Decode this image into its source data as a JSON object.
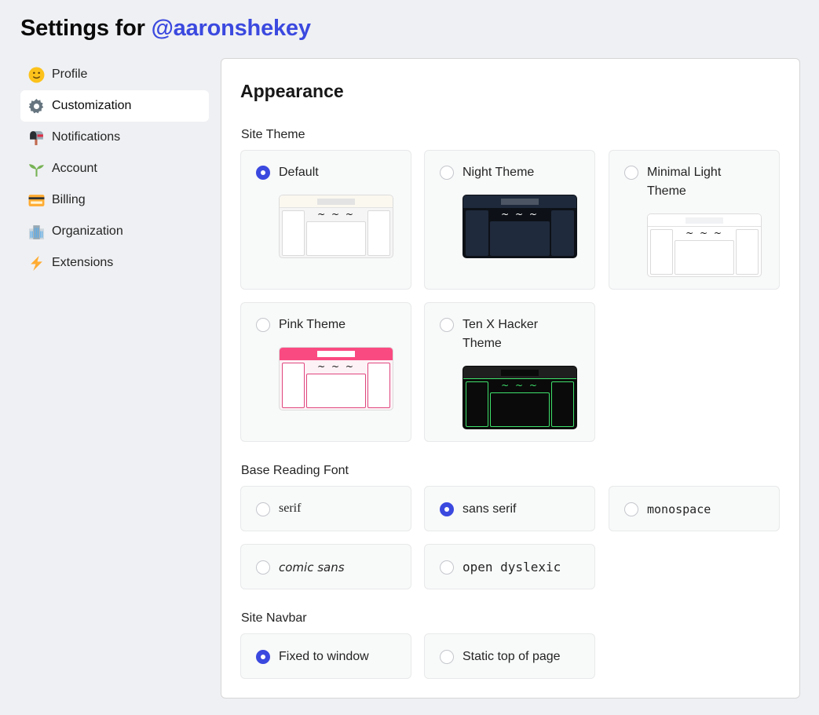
{
  "header": {
    "title_prefix": "Settings for ",
    "username": "@aaronshekey"
  },
  "sidebar": {
    "items": [
      {
        "label": "Profile",
        "icon": "smiley-face-icon",
        "active": false
      },
      {
        "label": "Customization",
        "icon": "gear-icon",
        "active": true
      },
      {
        "label": "Notifications",
        "icon": "mailbox-icon",
        "active": false
      },
      {
        "label": "Account",
        "icon": "seedling-icon",
        "active": false
      },
      {
        "label": "Billing",
        "icon": "credit-card-icon",
        "active": false
      },
      {
        "label": "Organization",
        "icon": "office-building-icon",
        "active": false
      },
      {
        "label": "Extensions",
        "icon": "lightning-bolt-icon",
        "active": false
      }
    ]
  },
  "panel": {
    "title": "Appearance",
    "site_theme": {
      "label": "Site Theme",
      "options": [
        {
          "label": "Default",
          "checked": true,
          "preview_tilde": "~ ~ ~"
        },
        {
          "label": "Night Theme",
          "checked": false,
          "preview_tilde": "~ ~ ~"
        },
        {
          "label": "Minimal Light Theme",
          "checked": false,
          "preview_tilde": "~ ~ ~"
        },
        {
          "label": "Pink Theme",
          "checked": false,
          "preview_tilde": "~ ~ ~"
        },
        {
          "label": "Ten X Hacker Theme",
          "checked": false,
          "preview_tilde": "~ ~ ~"
        }
      ],
      "colors": {
        "pink": "#fa4a82",
        "hacker_green": "#3ee06b",
        "night_bg": "#1e293b"
      }
    },
    "reading_font": {
      "label": "Base Reading Font",
      "options": [
        {
          "label": "serif",
          "checked": false
        },
        {
          "label": "sans serif",
          "checked": true
        },
        {
          "label": "monospace",
          "checked": false
        },
        {
          "label": "comic sans",
          "checked": false
        },
        {
          "label": "open dyslexic",
          "checked": false
        }
      ]
    },
    "navbar": {
      "label": "Site Navbar",
      "options": [
        {
          "label": "Fixed to window",
          "checked": true
        },
        {
          "label": "Static top of page",
          "checked": false
        }
      ]
    }
  },
  "colors": {
    "accent": "#3b49df",
    "background": "#eff0f3"
  }
}
